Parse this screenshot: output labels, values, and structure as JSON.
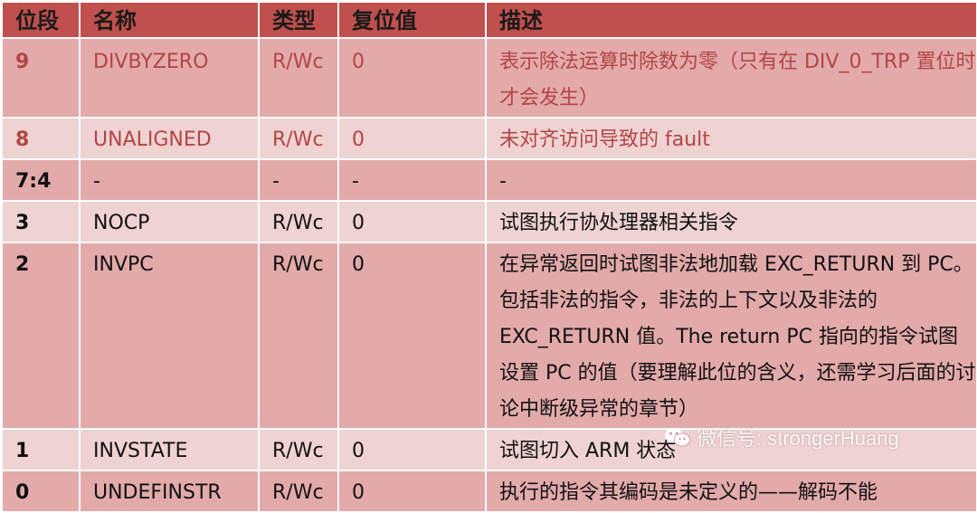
{
  "table": {
    "headers": [
      "位段",
      "名称",
      "类型",
      "复位值",
      "描述"
    ],
    "rows": [
      {
        "bit": "9",
        "name": "DIVBYZERO",
        "type": "R/Wc",
        "reset": "0",
        "desc": "表示除法运算时除数为零（只有在 DIV_0_TRP 置位时才会发生）"
      },
      {
        "bit": "8",
        "name": "UNALIGNED",
        "type": "R/Wc",
        "reset": "0",
        "desc": "未对齐访问导致的 fault"
      },
      {
        "bit": "7:4",
        "name": "-",
        "type": "-",
        "reset": "-",
        "desc": "-"
      },
      {
        "bit": "3",
        "name": "NOCP",
        "type": "R/Wc",
        "reset": "0",
        "desc": "试图执行协处理器相关指令"
      },
      {
        "bit": "2",
        "name": "INVPC",
        "type": "R/Wc",
        "reset": "0",
        "desc": "在异常返回时试图非法地加载 EXC_RETURN 到 PC。包括非法的指令，非法的上下文以及非法的 EXC_RETURN 值。The return PC 指向的指令试图设置 PC 的值（要理解此位的含义，还需学习后面的讨论中断级异常的章节）"
      },
      {
        "bit": "1",
        "name": "INVSTATE",
        "type": "R/Wc",
        "reset": "0",
        "desc": "试图切入 ARM 状态"
      },
      {
        "bit": "0",
        "name": "UNDEFINSTR",
        "type": "R/Wc",
        "reset": "0",
        "desc": "执行的指令其编码是未定义的——解码不能"
      }
    ]
  },
  "watermark": {
    "icon": "wechat-icon",
    "text": "微信号: strongerHuang"
  },
  "colors": {
    "header_bg": "#c0504d",
    "row_dark": "#e3aaaa",
    "row_light": "#efd2d2",
    "faded_text": "#b34545"
  }
}
